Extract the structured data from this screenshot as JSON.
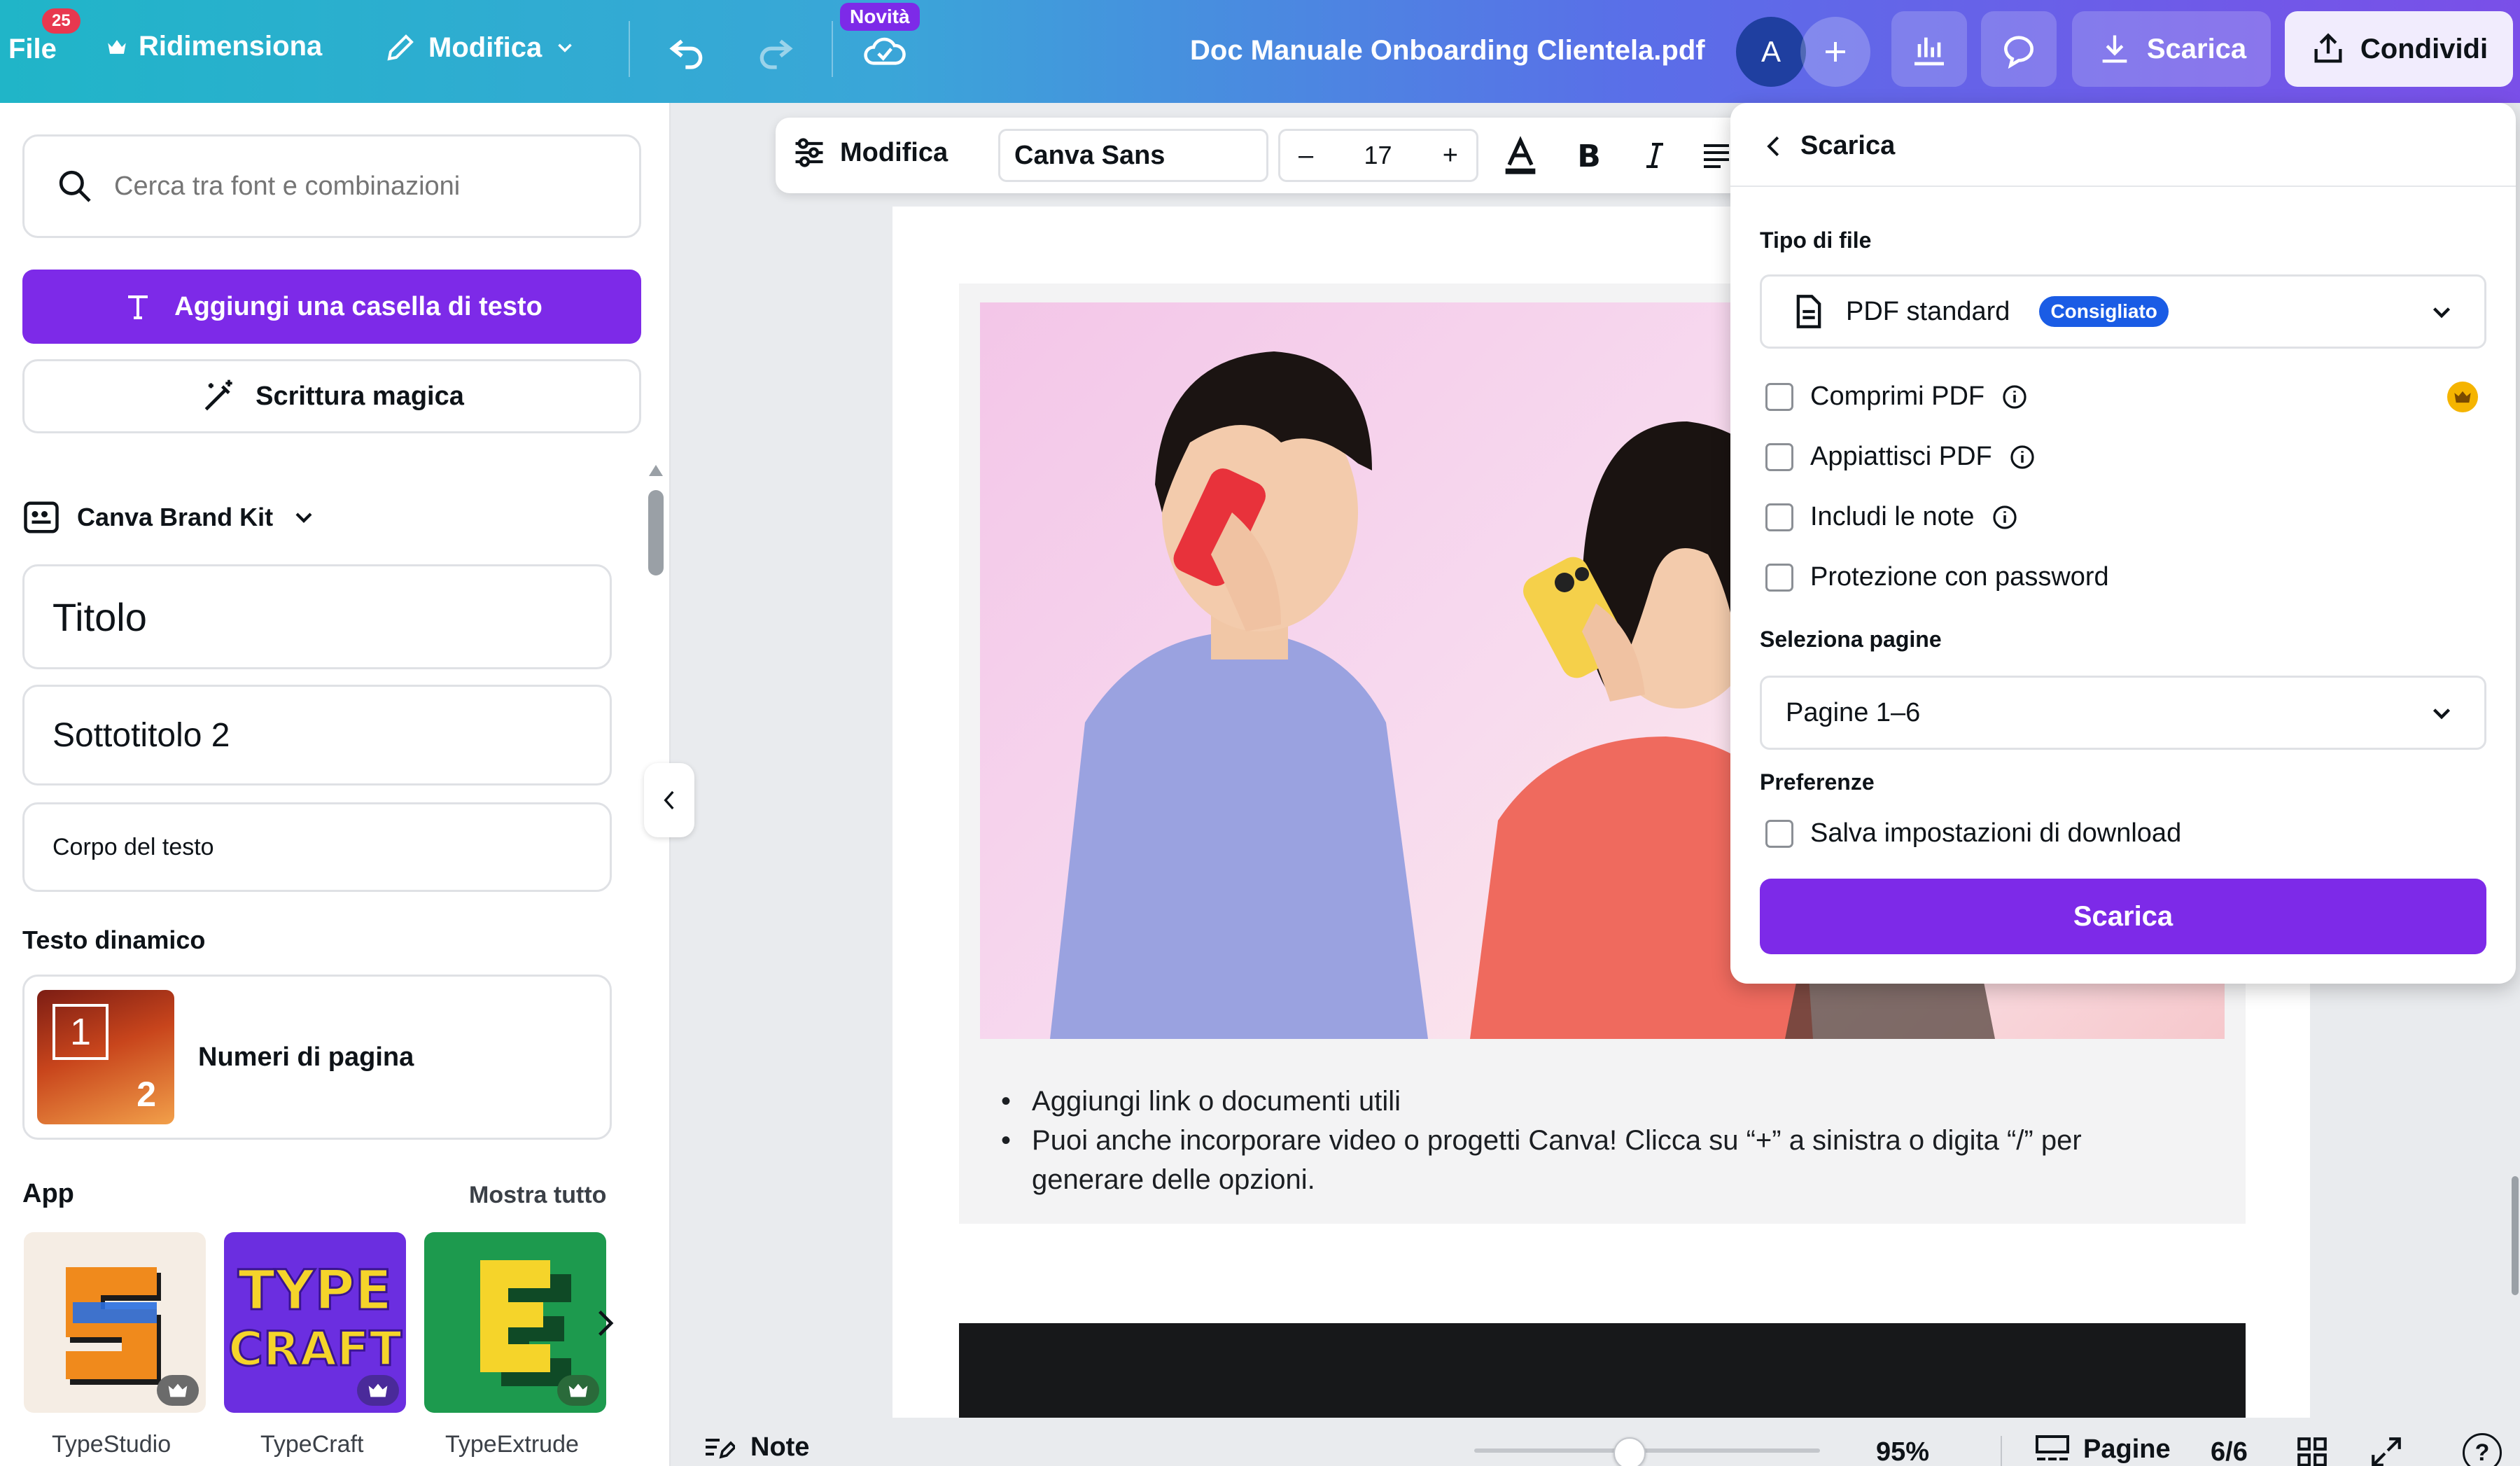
{
  "topbar": {
    "file_label": "File",
    "file_badge": "25",
    "resize_label": "Ridimensiona",
    "edit_label": "Modifica",
    "new_badge": "Novità",
    "doc_title": "Doc Manuale Onboarding Clientela.pdf",
    "avatar_letter": "A",
    "download_label": "Scarica",
    "share_label": "Condividi"
  },
  "left_panel": {
    "search_placeholder": "Cerca tra font e combinazioni",
    "add_textbox_label": "Aggiungi una casella di testo",
    "magic_write_label": "Scrittura magica",
    "brand_kit_label": "Canva Brand Kit",
    "styles": [
      {
        "label": "Titolo"
      },
      {
        "label": "Sottotitolo 2"
      },
      {
        "label": "Corpo del testo"
      }
    ],
    "dynamic_text_heading": "Testo dinamico",
    "page_numbers_label": "Numeri di pagina",
    "page_numbers_thumb_top": "1",
    "page_numbers_thumb_bottom": "2",
    "apps_heading": "App",
    "show_all_label": "Mostra tutto",
    "apps": [
      {
        "name": "TypeStudio"
      },
      {
        "name": "TypeCraft"
      },
      {
        "name": "TypeExtrude"
      }
    ]
  },
  "toolbar": {
    "edit_label": "Modifica",
    "font_name": "Canva Sans",
    "font_size": "17",
    "minus": "–",
    "plus": "+"
  },
  "page": {
    "bullets": [
      "Aggiungi link o documenti utili",
      "Puoi anche incorporare video o progetti Canva! Clicca su “+” a sinistra o digita “/” per generare delle opzioni."
    ]
  },
  "download_panel": {
    "title": "Scarica",
    "file_type_heading": "Tipo di file",
    "file_type_value": "PDF standard",
    "recommended_badge": "Consigliato",
    "options": [
      {
        "label": "Comprimi PDF",
        "info": true,
        "premium": true,
        "checked": false
      },
      {
        "label": "Appiattisci PDF",
        "info": true,
        "premium": false,
        "checked": false
      },
      {
        "label": "Includi le note",
        "info": true,
        "premium": false,
        "checked": false
      },
      {
        "label": "Protezione con password",
        "info": false,
        "premium": false,
        "checked": false
      }
    ],
    "pages_heading": "Seleziona pagine",
    "pages_value": "Pagine 1–6",
    "prefs_heading": "Preferenze",
    "save_settings_label": "Salva impostazioni di download",
    "download_button": "Scarica"
  },
  "bottombar": {
    "notes_label": "Note",
    "zoom_value": "95%",
    "zoom_fraction": 0.45,
    "pages_label": "Pagine",
    "page_counter": "6/6",
    "help_label": "?"
  },
  "colors": {
    "primary_purple": "#7d2ae8",
    "badge_blue": "#1a5ce5",
    "avatar_blue": "#1f3fa0"
  }
}
